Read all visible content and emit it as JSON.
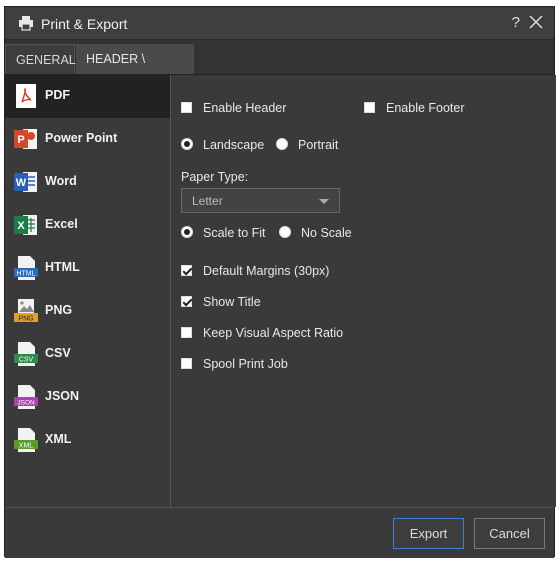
{
  "window": {
    "title": "Print & Export",
    "help_label": "?",
    "title_icon": "printer-icon",
    "close_icon": "close-icon"
  },
  "tabs": [
    {
      "label": "GENERAL",
      "selected": true
    },
    {
      "label": "HEADER \\ FOOTER",
      "selected": false
    }
  ],
  "sidebar": {
    "items": [
      {
        "label": "PDF",
        "icon": "pdf-icon",
        "selected": true
      },
      {
        "label": "Power Point",
        "icon": "powerpoint-icon"
      },
      {
        "label": "Word",
        "icon": "word-icon"
      },
      {
        "label": "Excel",
        "icon": "excel-icon"
      },
      {
        "label": "HTML",
        "icon": "html-file-icon",
        "badge": "HTML"
      },
      {
        "label": "PNG",
        "icon": "png-file-icon",
        "badge": "PNG"
      },
      {
        "label": "CSV",
        "icon": "csv-file-icon",
        "badge": "CSV"
      },
      {
        "label": "JSON",
        "icon": "json-file-icon",
        "badge": "JSON"
      },
      {
        "label": "XML",
        "icon": "xml-file-icon",
        "badge": "XML"
      }
    ]
  },
  "options": {
    "enable_header": {
      "label": "Enable Header",
      "checked": false
    },
    "enable_footer": {
      "label": "Enable Footer",
      "checked": false
    },
    "orientation": {
      "landscape": "Landscape",
      "portrait": "Portrait",
      "selected": "Landscape"
    },
    "paper_type": {
      "label": "Paper Type:",
      "value": "Letter"
    },
    "scaling": {
      "scale_to_fit": "Scale to Fit",
      "no_scale": "No Scale",
      "selected": "Scale to Fit"
    },
    "default_margins": {
      "label": "Default Margins (30px)",
      "checked": true
    },
    "show_title": {
      "label": "Show Title",
      "checked": true
    },
    "keep_aspect": {
      "label": "Keep Visual Aspect Ratio",
      "checked": false
    },
    "spool_print": {
      "label": "Spool Print Job",
      "checked": false
    }
  },
  "footer": {
    "export_label": "Export",
    "cancel_label": "Cancel"
  },
  "colors": {
    "accent": "#3d7fd4",
    "dialog_bg": "#3a3a3a",
    "pdf": "#e0392b",
    "powerpoint": "#d04a27",
    "word": "#2b5fb3",
    "excel": "#1f7a45",
    "html": "#2a6db8",
    "png": "#e0a020",
    "csv": "#2f8a4a",
    "json": "#b040b0",
    "xml": "#5c9a2c"
  }
}
